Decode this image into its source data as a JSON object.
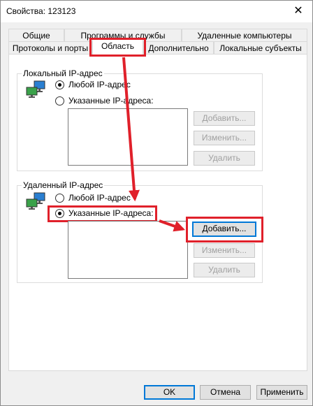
{
  "window": {
    "title": "Свойства: 123123",
    "close_glyph": "✕"
  },
  "tabs_row1": [
    "Общие",
    "Программы и службы",
    "Удаленные компьютеры"
  ],
  "tabs_row2": [
    "Протоколы и порты",
    "Область",
    "Дополнительно",
    "Локальные субъекты"
  ],
  "active_tab": "Область",
  "local_group": {
    "label": "Локальный IP-адрес",
    "option_any": "Любой IP-адрес",
    "option_specified": "Указанные IP-адреса:",
    "selected": "any",
    "buttons": {
      "add": "Добавить...",
      "edit": "Изменить...",
      "delete": "Удалить"
    }
  },
  "remote_group": {
    "label": "Удаленный IP-адрес",
    "option_any": "Любой IP-адрес",
    "option_specified": "Указанные IP-адреса:",
    "selected": "specified",
    "buttons": {
      "add": "Добавить...",
      "edit": "Изменить...",
      "delete": "Удалить"
    }
  },
  "footer": {
    "ok": "OK",
    "cancel": "Отмена",
    "apply": "Применить"
  },
  "colors": {
    "annotation": "#e0202a",
    "accent": "#0078d7"
  }
}
